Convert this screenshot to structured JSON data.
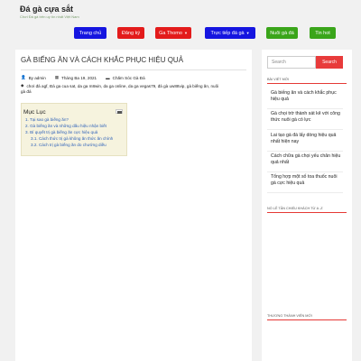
{
  "site": {
    "title": "Đá gà cựa sắt",
    "description": "Chơi Đá gà trên uy tín nhất Việt Nam"
  },
  "nav": {
    "items": [
      {
        "label": "Trang chủ",
        "color": "#1515e0"
      },
      {
        "label": "Đăng ký",
        "color": "#e31b1b"
      },
      {
        "label": "Ga Thomo",
        "color": "#e31b1b",
        "has_dropdown": true
      },
      {
        "label": "Trực tiếp đá gà",
        "color": "#1515e0",
        "has_dropdown": true
      },
      {
        "label": "Nuôi gà đá",
        "color": "#3aa51a"
      },
      {
        "label": "Tin hot",
        "color": "#3aa51a"
      }
    ]
  },
  "post": {
    "title": "GÀ BIẾNG ĂN VÀ CÁCH KHẮC PHỤC HIỆU QUẢ",
    "author": "By admin",
    "date": "Tháng Ba 19, 2021",
    "category": "Chăm Sóc Gà Đá",
    "tags_line1": "chơi đá agf, Đá ga cua sat, da ga m8win, da ga online, da ga vegas79, đá gà uw88vip, gà biếng ăn, nuôi",
    "tags_line2": "gà đá"
  },
  "toc": {
    "title": "Mục Lục",
    "items": [
      "1. Tại sao gà biếng ăn?",
      "2. Gà biếng ăn và những dấu hiệu nhận biết",
      "3. Bí quyết trị gà biếng ăn cực hiệu quả",
      "3.1. Cách thức trị gà không ăn thức ăn chính",
      "3.2. Cách trị gà biếng ăn do chướng diều"
    ]
  },
  "sidebar": {
    "search_placeholder": "Search",
    "search_button": "Search",
    "recent_title": "BÀI VIẾT MỚI",
    "recent_posts": [
      "Gà biếng ăn và cách khắc phục hiệu quả",
      "Gà chọi trờ thành sát kê với công thức nuôi gà có lực",
      "Lai tạo gà đá lấy dòng hiệu quả nhất hiện nay",
      "Cách chữa gà chọi yếu chân hiệu quả nhất",
      "Tổng hợp một số toa thuốc nuôi gà cực hiệu quả"
    ],
    "widget2_title": "NỔ LỄ TẦN CHIẾU KHÁCH TỪ A -Z",
    "widget3_title": "THƯƠNG THÀNH VIÊN MỚI"
  },
  "colors": {
    "accent_red": "#e83b3b",
    "link_blue": "#2b5fb8",
    "toc_bg": "#f6f3de"
  }
}
